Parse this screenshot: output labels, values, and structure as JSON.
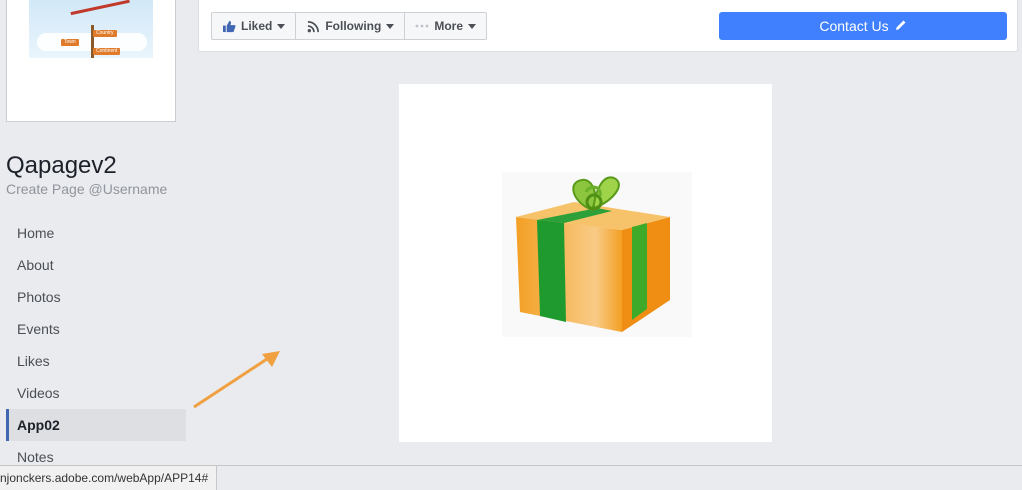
{
  "page": {
    "name": "Qapagev2",
    "username_prompt": "Create Page @Username",
    "profile_signs": [
      "Country",
      "Town",
      "Continent"
    ]
  },
  "nav": {
    "items": [
      {
        "label": "Home"
      },
      {
        "label": "About"
      },
      {
        "label": "Photos"
      },
      {
        "label": "Events"
      },
      {
        "label": "Likes"
      },
      {
        "label": "Videos"
      },
      {
        "label": "App02",
        "active": true
      },
      {
        "label": "Notes"
      }
    ]
  },
  "actionbar": {
    "liked_label": "Liked",
    "following_label": "Following",
    "more_label": "More",
    "contact_label": "Contact Us"
  },
  "statusbar": {
    "url": "njonckers.adobe.com/webApp/APP14#"
  },
  "colors": {
    "accent_blue": "#4080ff",
    "nav_active_border": "#4267b2",
    "arrow": "#f0a040"
  },
  "icons": [
    "thumbs-up-icon",
    "rss-icon",
    "more-dots-icon",
    "caret-down-icon",
    "pencil-icon",
    "gift-box-icon"
  ]
}
